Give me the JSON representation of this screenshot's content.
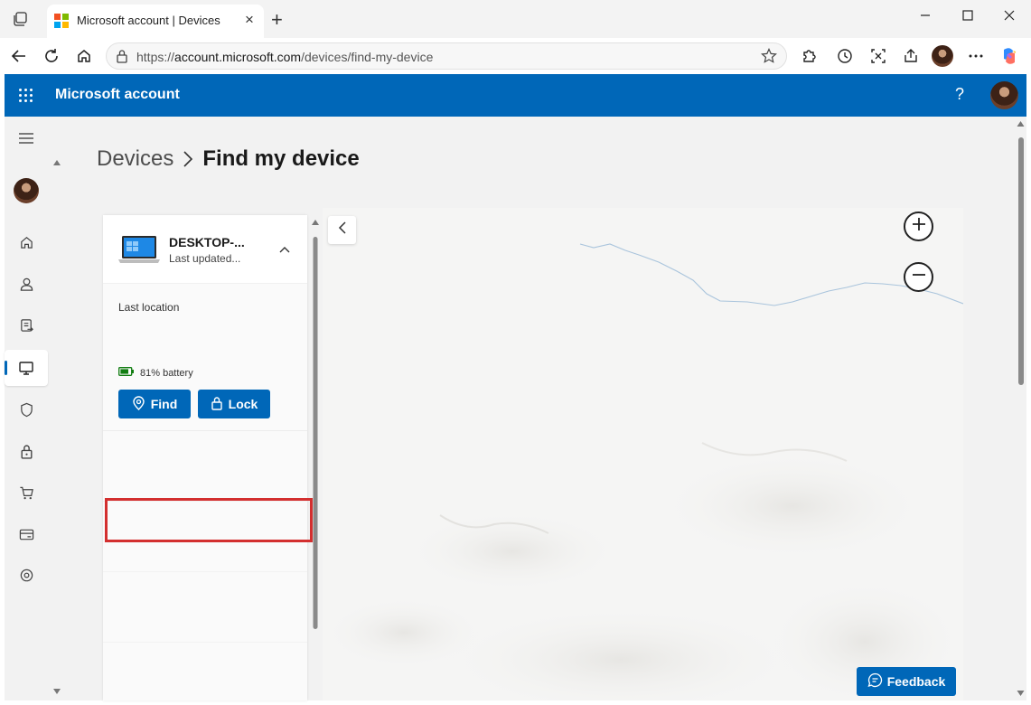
{
  "browser": {
    "tab_title": "Microsoft account | Devices",
    "url_host": "account.microsoft.com",
    "url_prefix": "https://",
    "url_path": "/devices/find-my-device"
  },
  "app": {
    "title": "Microsoft account",
    "help_label": "?"
  },
  "breadcrumb": {
    "parent": "Devices",
    "current": "Find my device"
  },
  "device": {
    "name": "DESKTOP-...",
    "updated": "Last updated...",
    "location_label": "Last location",
    "battery_text": "81% battery",
    "battery_level": 0.81,
    "find_label": "Find",
    "lock_label": "Lock"
  },
  "feedback_label": "Feedback",
  "colors": {
    "brand": "#0067b8",
    "highlight": "#d32f2f",
    "battery": "#107c10"
  },
  "nav_icons": [
    "menu-icon",
    "avatar",
    "home-icon",
    "person-icon",
    "rewards-icon",
    "devices-icon",
    "shield-icon",
    "lock-icon",
    "cart-icon",
    "payment-card-icon",
    "location-pin-icon"
  ]
}
